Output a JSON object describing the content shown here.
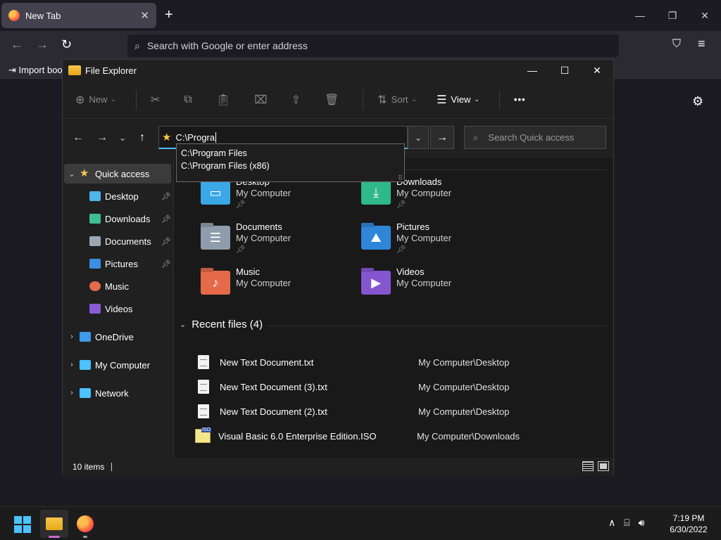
{
  "browser": {
    "tab_title": "New Tab",
    "tab_close": "✕",
    "new_tab": "+",
    "url_placeholder": "Search with Google or enter address",
    "import_bookmarks": "Import boo"
  },
  "explorer": {
    "title": "File Explorer",
    "toolbar": {
      "new_label": "New",
      "sort_label": "Sort",
      "view_label": "View",
      "more": "•••"
    },
    "address_text": "C:\\Progra",
    "search_placeholder": "Search Quick access",
    "autocomplete": [
      "C:\\Program Files",
      "C:\\Program Files (x86)"
    ],
    "sidebar": [
      {
        "label": "Quick access",
        "icon": "star-icon",
        "color": "#f6c64a",
        "chevron": "⌄",
        "selected": true
      },
      {
        "label": "Desktop",
        "icon": "desktop-icon",
        "color": "#4fb4e8",
        "pinned": true
      },
      {
        "label": "Downloads",
        "icon": "download-icon",
        "color": "#3fbf8f",
        "pinned": true
      },
      {
        "label": "Documents",
        "icon": "document-icon",
        "color": "#9aa7b5",
        "pinned": true
      },
      {
        "label": "Pictures",
        "icon": "pictures-icon",
        "color": "#3d8fe0",
        "pinned": true
      },
      {
        "label": "Music",
        "icon": "music-icon",
        "color": "#e66b4d"
      },
      {
        "label": "Videos",
        "icon": "videos-icon",
        "color": "#8a5cd6"
      },
      {
        "label": "OneDrive",
        "icon": "cloud-icon",
        "color": "#3d9be9",
        "chevron": "›"
      },
      {
        "label": "My Computer",
        "icon": "computer-icon",
        "color": "#4cc2ff",
        "chevron": "›"
      },
      {
        "label": "Network",
        "icon": "network-icon",
        "color": "#4cc2ff",
        "chevron": "›"
      }
    ],
    "quick_access": [
      {
        "name": "Desktop",
        "location": "My Computer",
        "pinned": true,
        "color": "#3aa7e6"
      },
      {
        "name": "Downloads",
        "location": "My Computer",
        "pinned": true,
        "color": "#2fb88a"
      },
      {
        "name": "Documents",
        "location": "My Computer",
        "pinned": true,
        "color": "#8f9cab"
      },
      {
        "name": "Pictures",
        "location": "My Computer",
        "pinned": true,
        "color": "#2f86d9"
      },
      {
        "name": "Music",
        "location": "My Computer",
        "pinned": false,
        "color": "#e56a4a"
      },
      {
        "name": "Videos",
        "location": "My Computer",
        "pinned": false,
        "color": "#8656d0"
      }
    ],
    "recent_header": "Recent files (4)",
    "recent_files": [
      {
        "name": "New Text Document.txt",
        "location": "My Computer\\Desktop",
        "type": "txt"
      },
      {
        "name": "New Text Document (3).txt",
        "location": "My Computer\\Desktop",
        "type": "txt"
      },
      {
        "name": "New Text Document (2).txt",
        "location": "My Computer\\Desktop",
        "type": "txt"
      },
      {
        "name": "Visual Basic 6.0 Enterprise Edition.ISO",
        "location": "My Computer\\Downloads",
        "type": "iso"
      }
    ],
    "status_items": "10 items"
  },
  "taskbar": {
    "time": "7:19 PM",
    "date": "6/30/2022"
  },
  "colors": {
    "accent": "#4cc2ff",
    "folder": "#f6c64a"
  }
}
